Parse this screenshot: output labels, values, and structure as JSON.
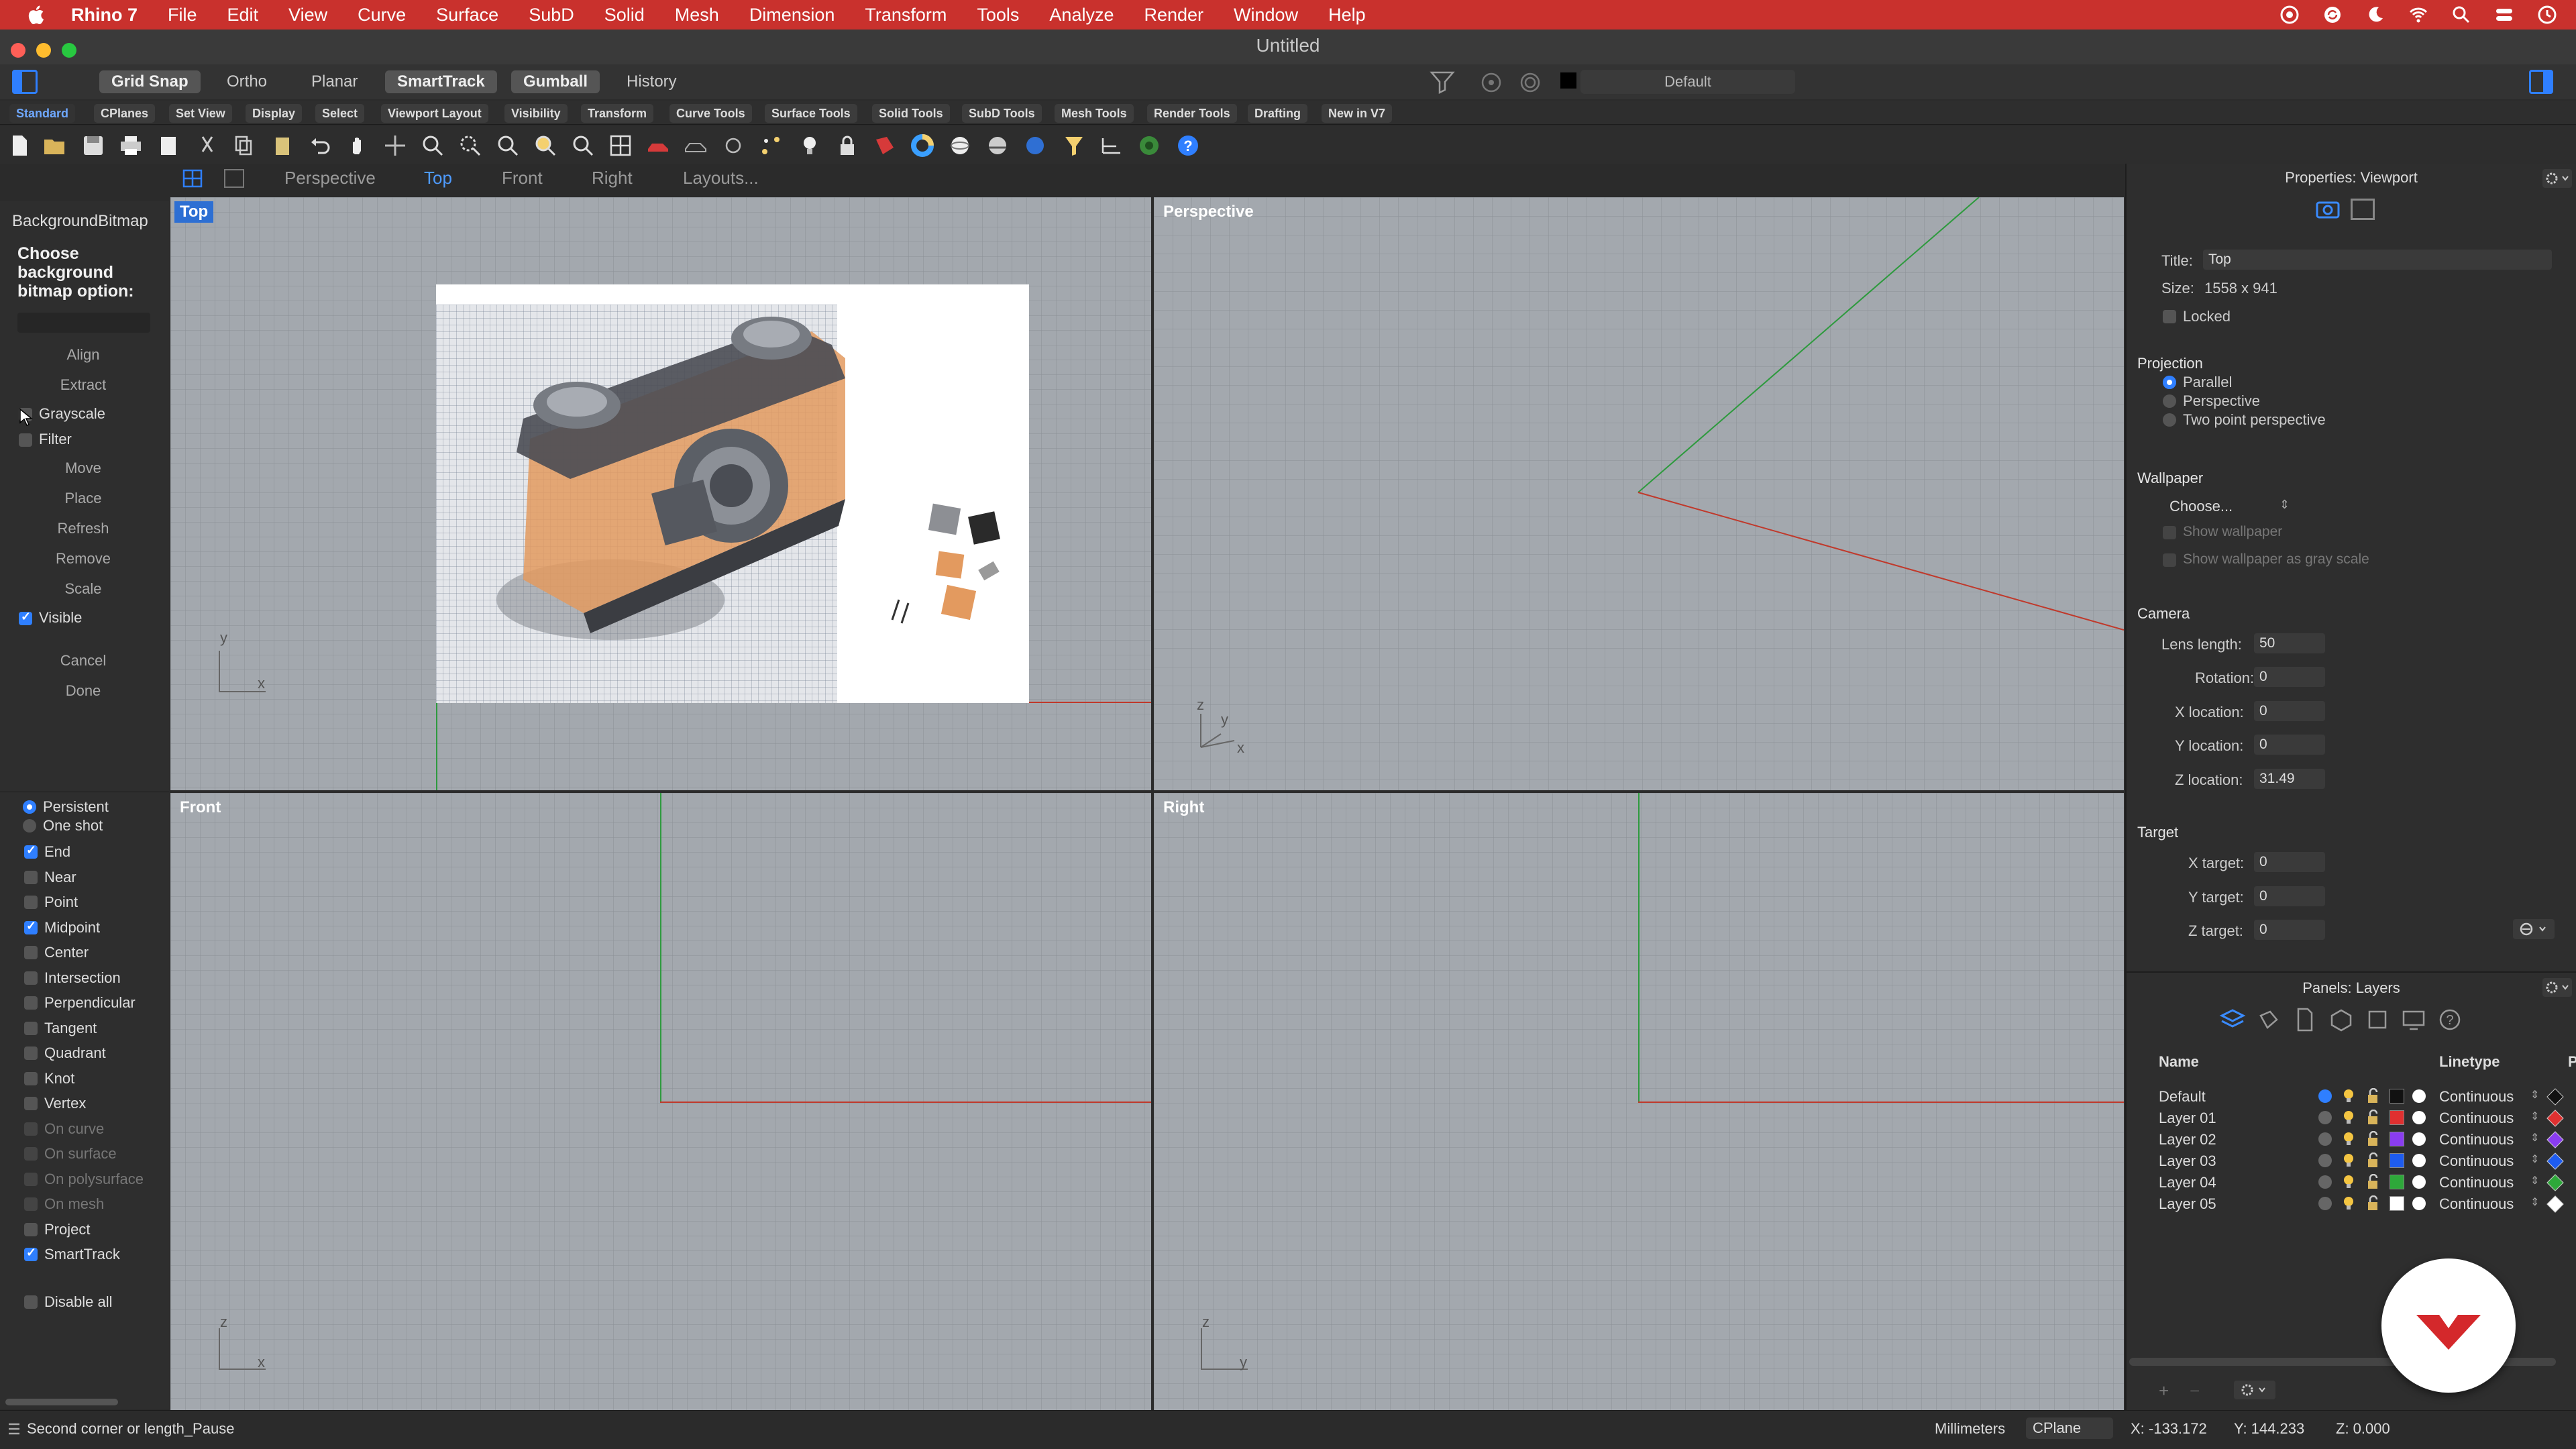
{
  "menubar": {
    "items": [
      "Rhino 7",
      "File",
      "Edit",
      "View",
      "Curve",
      "Surface",
      "SubD",
      "Solid",
      "Mesh",
      "Dimension",
      "Transform",
      "Tools",
      "Analyze",
      "Render",
      "Window",
      "Help"
    ],
    "icons": [
      "apple-icon",
      "creative-cloud-icon",
      "sync-icon",
      "moon-icon",
      "wifi-icon",
      "search-icon",
      "control-center-icon",
      "clock-icon"
    ]
  },
  "window": {
    "title": "Untitled"
  },
  "modebar": {
    "buttons": [
      {
        "label": "Grid Snap",
        "on": true
      },
      {
        "label": "Ortho",
        "on": false
      },
      {
        "label": "Planar",
        "on": false
      },
      {
        "label": "SmartTrack",
        "on": true
      },
      {
        "label": "Gumball",
        "on": true
      },
      {
        "label": "History",
        "on": false
      }
    ],
    "layer_name": "Default"
  },
  "tool_tabs": [
    "Standard",
    "CPlanes",
    "Set View",
    "Display",
    "Select",
    "Viewport Layout",
    "Visibility",
    "Transform",
    "Curve Tools",
    "Surface Tools",
    "Solid Tools",
    "SubD Tools",
    "Mesh Tools",
    "Render Tools",
    "Drafting",
    "New in V7"
  ],
  "viewport_tabs": [
    "Perspective",
    "Top",
    "Front",
    "Right",
    "Layouts..."
  ],
  "command_panel": {
    "header": "BackgroundBitmap",
    "prompt": "Choose background bitmap option:",
    "buttons": [
      "Align",
      "Extract",
      "Move",
      "Place",
      "Refresh",
      "Remove",
      "Scale",
      "Cancel",
      "Done"
    ],
    "checks": [
      {
        "label": "Grayscale",
        "checked": false
      },
      {
        "label": "Filter",
        "checked": false
      },
      {
        "label": "Visible",
        "checked": true
      }
    ]
  },
  "osnap": {
    "modes": [
      {
        "label": "Persistent",
        "on": true
      },
      {
        "label": "One shot",
        "on": false
      }
    ],
    "items": [
      {
        "label": "End",
        "checked": true,
        "dim": false
      },
      {
        "label": "Near",
        "checked": false,
        "dim": false
      },
      {
        "label": "Point",
        "checked": false,
        "dim": false
      },
      {
        "label": "Midpoint",
        "checked": true,
        "dim": false
      },
      {
        "label": "Center",
        "checked": false,
        "dim": false
      },
      {
        "label": "Intersection",
        "checked": false,
        "dim": false
      },
      {
        "label": "Perpendicular",
        "checked": false,
        "dim": false
      },
      {
        "label": "Tangent",
        "checked": false,
        "dim": false
      },
      {
        "label": "Quadrant",
        "checked": false,
        "dim": false
      },
      {
        "label": "Knot",
        "checked": false,
        "dim": false
      },
      {
        "label": "Vertex",
        "checked": false,
        "dim": false
      },
      {
        "label": "On curve",
        "checked": false,
        "dim": true
      },
      {
        "label": "On surface",
        "checked": false,
        "dim": true
      },
      {
        "label": "On polysurface",
        "checked": false,
        "dim": true
      },
      {
        "label": "On mesh",
        "checked": false,
        "dim": true
      },
      {
        "label": "Project",
        "checked": false,
        "dim": false
      },
      {
        "label": "SmartTrack",
        "checked": true,
        "dim": false
      }
    ],
    "disable_all": "Disable all"
  },
  "viewports": {
    "top": {
      "label": "Top",
      "axis_x": "x",
      "axis_y": "y"
    },
    "perspective": {
      "label": "Perspective",
      "axis_x": "x",
      "axis_y": "y",
      "axis_z": "z"
    },
    "front": {
      "label": "Front",
      "axis_x": "x",
      "axis_z": "z"
    },
    "right": {
      "label": "Right",
      "axis_y": "y",
      "axis_z": "z"
    }
  },
  "properties": {
    "title": "Properties: Viewport",
    "title_label": "Title:",
    "title_value": "Top",
    "size_label": "Size:",
    "size_value": "1558 x 941",
    "locked_label": "Locked",
    "projection": {
      "heading": "Projection",
      "options": [
        {
          "label": "Parallel",
          "on": true
        },
        {
          "label": "Perspective",
          "on": false
        },
        {
          "label": "Two point perspective",
          "on": false
        }
      ]
    },
    "wallpaper": {
      "heading": "Wallpaper",
      "choose": "Choose...",
      "show": "Show wallpaper",
      "show_gray": "Show wallpaper as gray scale"
    },
    "camera": {
      "heading": "Camera",
      "fields": [
        {
          "label": "Lens length:",
          "value": "50"
        },
        {
          "label": "Rotation:",
          "value": "0"
        },
        {
          "label": "X location:",
          "value": "0"
        },
        {
          "label": "Y location:",
          "value": "0"
        },
        {
          "label": "Z location:",
          "value": "31.49"
        }
      ]
    },
    "target": {
      "heading": "Target",
      "fields": [
        {
          "label": "X target:",
          "value": "0"
        },
        {
          "label": "Y target:",
          "value": "0"
        },
        {
          "label": "Z target:",
          "value": "0"
        }
      ]
    }
  },
  "layers": {
    "title": "Panels: Layers",
    "col_name": "Name",
    "col_linetype": "Linetype",
    "col_p": "P",
    "rows": [
      {
        "name": "Default",
        "color": "#111111",
        "linetype": "Continuous",
        "current": true
      },
      {
        "name": "Layer 01",
        "color": "#e03030",
        "linetype": "Continuous",
        "current": false
      },
      {
        "name": "Layer 02",
        "color": "#8a3cf0",
        "linetype": "Continuous",
        "current": false
      },
      {
        "name": "Layer 03",
        "color": "#1e5cf0",
        "linetype": "Continuous",
        "current": false
      },
      {
        "name": "Layer 04",
        "color": "#2ea83a",
        "linetype": "Continuous",
        "current": false
      },
      {
        "name": "Layer 05",
        "color": "#ffffff",
        "linetype": "Continuous",
        "current": false
      }
    ]
  },
  "statusbar": {
    "command": "Second corner or length_Pause",
    "units": "Millimeters",
    "cplane": "CPlane",
    "x": "X: -133.172",
    "y": "Y: 144.233",
    "z": "Z: 0.000"
  },
  "colors": {
    "menubar": "#c9312d",
    "accent": "#2f7fff",
    "viewport_bg": "#a3a8ae",
    "x_axis": "#c0392b",
    "y_axis": "#2e9a3e",
    "camera_body_orange": "#e39a5f"
  }
}
